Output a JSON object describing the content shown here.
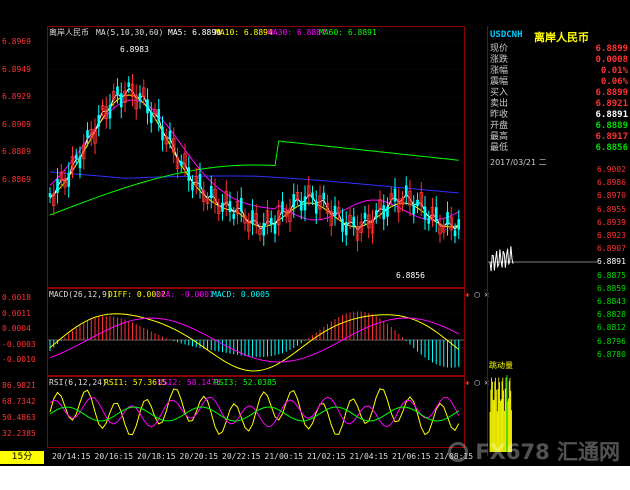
{
  "main": {
    "title": "离岸人民币",
    "ma_label": "MA(5,10,30,60)",
    "ma5": "MA5: 6.8890",
    "ma10": "MA10: 6.8894",
    "ma30": "MA30: 6.8887",
    "ma60": "MA60: 6.8891",
    "y_ticks": [
      "6.8969",
      "6.8949",
      "6.8929",
      "6.8909",
      "6.8889",
      "6.8869"
    ],
    "high_marker": "6.8983",
    "low_marker": "6.8856"
  },
  "macd": {
    "label": "MACD(26,12,9)",
    "diff": "DIFF: 0.0002",
    "dea": "DEA: -0.0001",
    "macd": "MACD: 0.0005",
    "y_ticks": [
      "0.0018",
      "0.0011",
      "0.0004",
      "-0.0003",
      "-0.0010"
    ]
  },
  "rsi": {
    "label": "RSI(6,12,24)",
    "rsi1": "RSI1: 57.3615",
    "rsi2": "RSI2: 58.1473",
    "rsi3": "RSI3: 52.0385",
    "y_ticks": [
      "86.9821",
      "68.7342",
      "50.4863",
      "32.2385"
    ]
  },
  "x_ticks": [
    "20/14:15",
    "20/16:15",
    "20/18:15",
    "20/20:15",
    "20/22:15",
    "21/00:15",
    "21/02:15",
    "21/04:15",
    "21/06:15",
    "21/08:15"
  ],
  "period": "15分",
  "sidebar": {
    "symbol": "USDCNH",
    "name": "离岸人民币",
    "rows": [
      {
        "label": "现价",
        "value": "6.8899",
        "color": "#ff3333"
      },
      {
        "label": "涨跌",
        "value": "0.0008",
        "color": "#ff3333"
      },
      {
        "label": "涨幅",
        "value": "0.01%",
        "color": "#ff3333"
      },
      {
        "label": "震幅",
        "value": "0.06%",
        "color": "#ff3333"
      },
      {
        "label": "买入",
        "value": "6.8899",
        "color": "#ff3333"
      },
      {
        "label": "卖出",
        "value": "6.8921",
        "color": "#ff3333"
      },
      {
        "label": "昨收",
        "value": "6.8891",
        "color": "#ffffff"
      },
      {
        "label": "开盘",
        "value": "6.8889",
        "color": "#00dd00"
      },
      {
        "label": "最高",
        "value": "6.8917",
        "color": "#ff3333"
      },
      {
        "label": "最低",
        "value": "6.8856",
        "color": "#00dd00"
      }
    ],
    "date": "2017/03/21 二",
    "mini_ticks": [
      "6.9002",
      "6.8986",
      "6.8970",
      "6.8955",
      "6.8939",
      "6.8923",
      "6.8907",
      "6.8891",
      "6.8875",
      "6.8859",
      "6.8843",
      "6.8828",
      "6.8812",
      "6.8796",
      "6.8780"
    ],
    "volume_label": "跳动量"
  },
  "watermark": "FX678 汇通网",
  "colors": {
    "up": "#ff3030",
    "down": "#00ffff",
    "ma5": "#ffffff",
    "ma10": "#ffff00",
    "ma30": "#ff00ff",
    "ma60": "#00ff00",
    "ma_long": "#3030ff"
  }
}
